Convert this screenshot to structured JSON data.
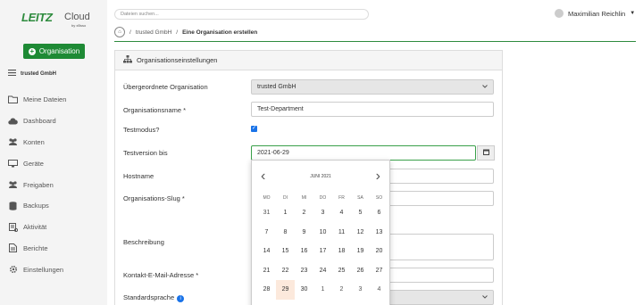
{
  "app": {
    "logo_brand": "LEITZ",
    "logo_cloud": "Cloud",
    "logo_by": "by xBsso"
  },
  "sidebar": {
    "org_button": "Organisation",
    "tenant": "trusted GmbH",
    "items": [
      {
        "label": "Meine Dateien",
        "icon": "folder-icon"
      },
      {
        "label": "Dashboard",
        "icon": "cloud-icon"
      },
      {
        "label": "Konten",
        "icon": "users-icon"
      },
      {
        "label": "Geräte",
        "icon": "monitor-icon"
      },
      {
        "label": "Freigaben",
        "icon": "share-users-icon"
      },
      {
        "label": "Backups",
        "icon": "database-icon"
      },
      {
        "label": "Aktivität",
        "icon": "activity-list-icon"
      },
      {
        "label": "Berichte",
        "icon": "report-icon"
      },
      {
        "label": "Einstellungen",
        "icon": "gear-icon"
      }
    ]
  },
  "topbar": {
    "search_placeholder": "Dateien suchen...",
    "user_name": "Maximilian Reichlin"
  },
  "breadcrumb": {
    "sep1": "/",
    "item1": "trusted GmbH",
    "sep2": "/",
    "current": "Eine Organisation erstellen"
  },
  "form": {
    "panel_title": "Organisationseinstellungen",
    "parent_org_label": "Übergeordnete Organisation",
    "parent_org_value": "trusted GmbH",
    "org_name_label": "Organisationsname *",
    "org_name_value": "Test-Department",
    "test_mode_label": "Testmodus?",
    "test_mode_checked": true,
    "test_until_label": "Testversion bis",
    "test_until_value": "2021-06-29",
    "hostname_label": "Hostname",
    "slug_label": "Organisations-Slug *",
    "description_label": "Beschreibung",
    "email_label": "Kontakt-E-Mail-Adresse *",
    "language_label": "Standardsprache"
  },
  "datepicker": {
    "month": "JUNI 2021",
    "weekdays": [
      "MO",
      "DI",
      "MI",
      "DO",
      "FR",
      "SA",
      "SO"
    ],
    "weeks": [
      [
        "31",
        "1",
        "2",
        "3",
        "4",
        "5",
        "6"
      ],
      [
        "7",
        "8",
        "9",
        "10",
        "11",
        "12",
        "13"
      ],
      [
        "14",
        "15",
        "16",
        "17",
        "18",
        "19",
        "20"
      ],
      [
        "21",
        "22",
        "23",
        "24",
        "25",
        "26",
        "27"
      ],
      [
        "28",
        "29",
        "30",
        "1",
        "2",
        "3",
        "4"
      ]
    ],
    "selected": "29"
  },
  "colors": {
    "accent": "#1e8a35",
    "selected_day_bg": "#fce9dc"
  }
}
